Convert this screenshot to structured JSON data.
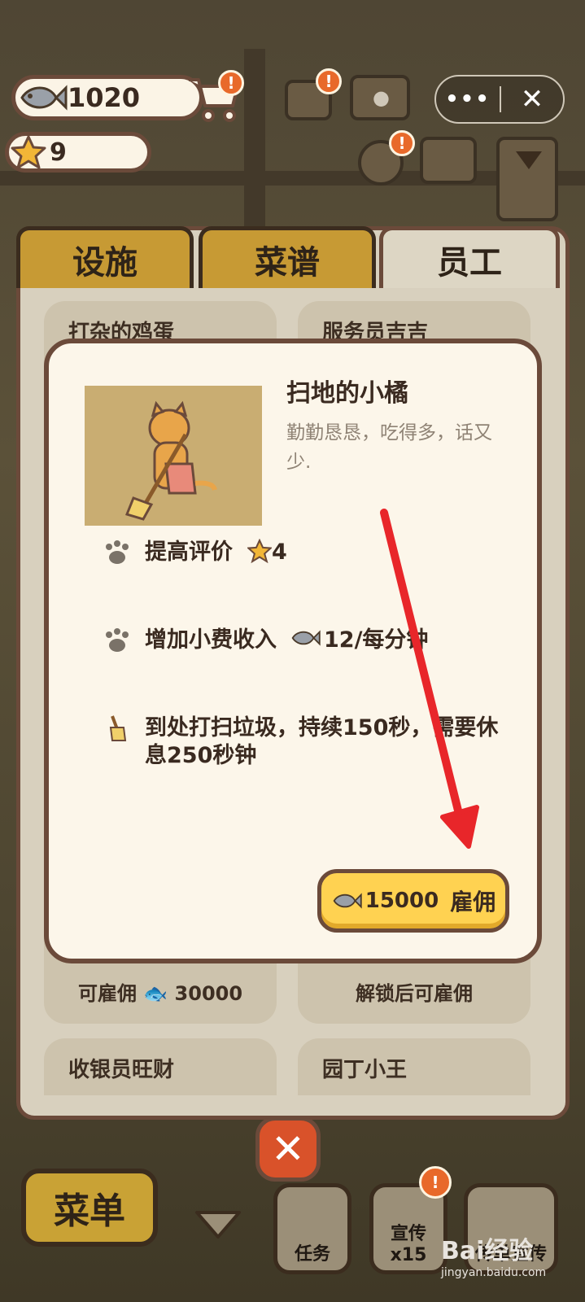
{
  "hud": {
    "fish_count": "1020",
    "star_count": "9",
    "notify_badge": "!"
  },
  "capsule": {
    "more_label": "•••",
    "close_label": "✕"
  },
  "tabs": [
    {
      "label": "设施"
    },
    {
      "label": "菜谱"
    },
    {
      "label": "员工"
    }
  ],
  "staff_cards": [
    {
      "title": "打杂的鸡蛋",
      "footer": "可雇佣 🐟 30000"
    },
    {
      "title": "服务员吉吉",
      "footer": "解锁后可雇佣"
    },
    {
      "title": "收银员旺财"
    },
    {
      "title": "园丁小王"
    }
  ],
  "modal": {
    "name": "扫地的小橘",
    "description": "勤勤恳恳，吃得多，话又少.",
    "attrs": [
      {
        "text": "提高评价",
        "value": "4"
      },
      {
        "text": "增加小费收入",
        "value": "12/每分钟"
      },
      {
        "text": "到处打扫垃圾，持续150秒，需要休息250秒钟"
      }
    ],
    "price": "15000",
    "hire_label": "雇佣"
  },
  "bottom": {
    "menu_label": "菜单",
    "close_symbol": "✕",
    "task_label": "任务",
    "promo_label": "宣传x15",
    "flyer_label": "传单宣传"
  },
  "watermark": {
    "brand": "Bai经验",
    "url": "jingyan.baidu.com"
  },
  "colors": {
    "accent_gold": "#ffd251",
    "tab_gold": "#c79a34",
    "border_brown": "#6b4a3a",
    "alert_orange": "#e8692a",
    "arrow_red": "#e8262a"
  }
}
